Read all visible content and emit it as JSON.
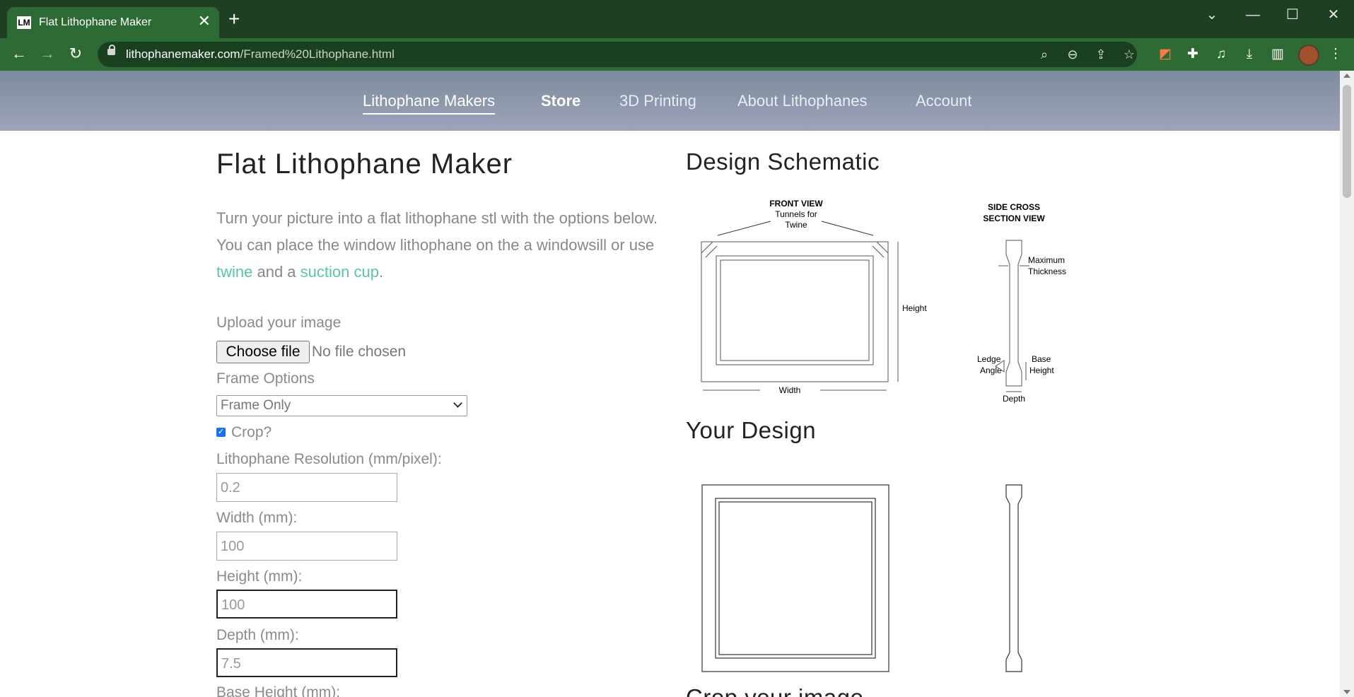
{
  "browser": {
    "tab_favicon": "LM",
    "tab_title": "Flat Lithophane Maker",
    "url_domain": "lithophanemaker.com",
    "url_path": "/Framed%20Lithophane.html",
    "icons": {
      "close": "✕",
      "new_tab": "+",
      "menu_down": "⌄",
      "minimize": "—",
      "maximize": "☐",
      "window_close": "✕",
      "back": "←",
      "forward": "→",
      "reload": "↻",
      "search": "⌕",
      "zoom_out": "⊖",
      "share": "⇪",
      "bookmark": "☆",
      "extension_a": "◩",
      "extensions": "✚",
      "media": "♫",
      "download": "⤓",
      "sidebar": "▥",
      "more": "⋮"
    }
  },
  "site_nav": {
    "items": [
      "Lithophane Makers",
      "Store",
      "3D Printing",
      "About Lithophanes",
      "Account"
    ]
  },
  "left": {
    "title": "Flat Lithophane Maker",
    "intro_before": "Turn your picture into a flat lithophane stl with the options below. You can place the window lithophane on the a windowsill or use ",
    "intro_link1": "twine",
    "intro_mid": " and a ",
    "intro_link2": "suction cup",
    "intro_after": ".",
    "upload_label": "Upload your image",
    "choose_file": "Choose file",
    "no_file": "No file chosen",
    "frame_options_label": "Frame Options",
    "frame_option_selected": "Frame Only",
    "crop_label": "Crop?",
    "crop_checked": true,
    "checkmark": "✓",
    "resolution_label": "Lithophane Resolution (mm/pixel):",
    "resolution_value": "0.2",
    "width_label": "Width (mm):",
    "width_value": "100",
    "height_label": "Height (mm):",
    "height_value": "100",
    "depth_label": "Depth (mm):",
    "depth_value": "7.5",
    "base_height_label": "Base Height (mm):"
  },
  "right": {
    "schematic_title": "Design Schematic",
    "schematic": {
      "front_view": "FRONT VIEW",
      "tunnels_1": "Tunnels for",
      "tunnels_2": "Twine",
      "height": "Height",
      "width": "Width",
      "side_1": "SIDE CROSS",
      "side_2": "SECTION VIEW",
      "max_1": "Maximum",
      "max_2": "Thickness",
      "ledge_1": "Ledge",
      "ledge_2": "Angle",
      "base_1": "Base",
      "base_2": "Height",
      "depth": "Depth"
    },
    "design_title": "Your Design",
    "next_heading": "Crop your image"
  },
  "colors": {
    "chrome_dark": "#1e3f22",
    "chrome_tab": "#2e6b34",
    "link": "#5bc5a8",
    "checkbox": "#1a73e8"
  }
}
